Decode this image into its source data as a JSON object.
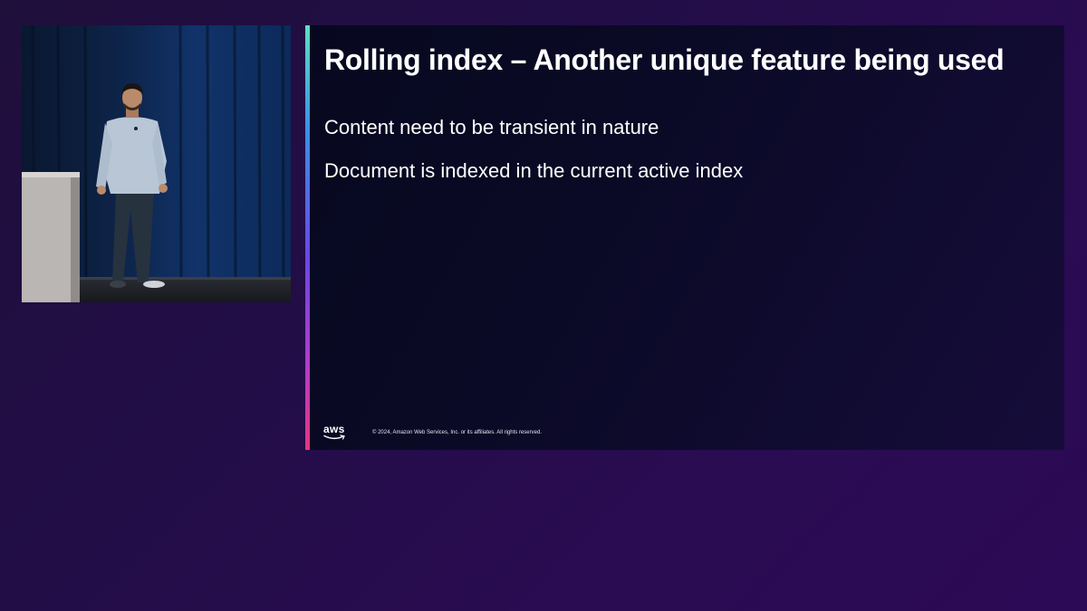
{
  "slide": {
    "title": "Rolling index – Another unique feature being used",
    "bullets": [
      "Content need to be transient in nature",
      "Document is indexed in the current active index"
    ],
    "footer": {
      "logo_text": "aws",
      "copyright": "© 2024, Amazon Web Services, Inc. or its affiliates. All rights reserved."
    }
  },
  "colors": {
    "background": "#230d48",
    "slide_background": "#0b0a27",
    "text": "#ffffff",
    "accent_top": "#5ce0c4",
    "accent_bottom": "#e6367a"
  }
}
